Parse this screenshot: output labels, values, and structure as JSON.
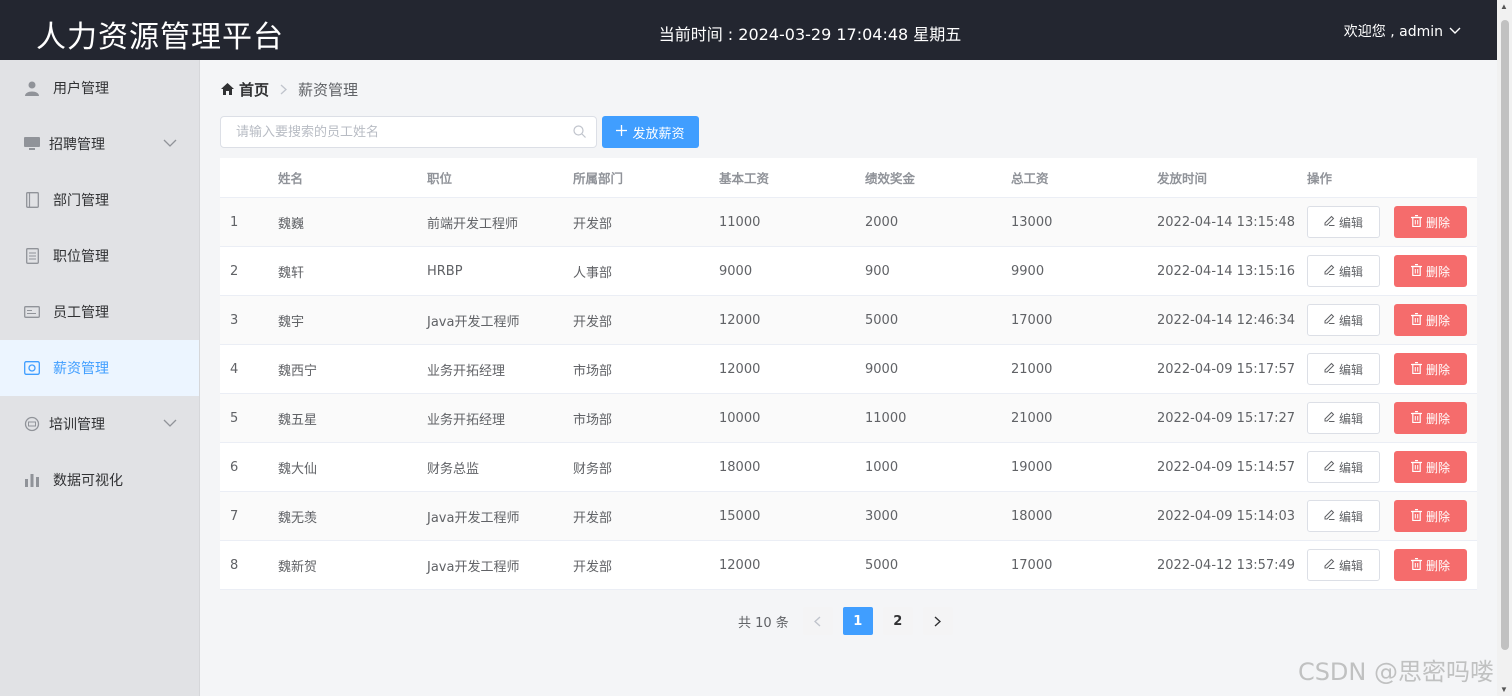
{
  "header": {
    "title": "人力资源管理平台",
    "clock": "当前时间 : 2024-03-29 17:04:48 星期五",
    "user": "欢迎您 , admin"
  },
  "sidebar": {
    "items": [
      {
        "label": "用户管理",
        "icon": "user-icon"
      },
      {
        "label": "招聘管理",
        "icon": "monitor-icon",
        "expandable": true
      },
      {
        "label": "部门管理",
        "icon": "notebook-icon"
      },
      {
        "label": "职位管理",
        "icon": "document-icon"
      },
      {
        "label": "员工管理",
        "icon": "id-card-icon"
      },
      {
        "label": "薪资管理",
        "icon": "money-icon",
        "active": true
      },
      {
        "label": "培训管理",
        "icon": "training-icon",
        "expandable": true
      },
      {
        "label": "数据可视化",
        "icon": "bar-chart-icon"
      }
    ]
  },
  "breadcrumb": {
    "home": "首页",
    "current": "薪资管理"
  },
  "search": {
    "placeholder": "请输入要搜索的员工姓名",
    "value": ""
  },
  "toolbar": {
    "add_label": "发放薪资"
  },
  "table": {
    "headers": [
      "",
      "姓名",
      "职位",
      "所属部门",
      "基本工资",
      "绩效奖金",
      "总工资",
      "发放时间",
      "操作"
    ],
    "rows": [
      [
        "1",
        "魏巍",
        "前端开发工程师",
        "开发部",
        "11000",
        "2000",
        "13000",
        "2022-04-14 13:15:48"
      ],
      [
        "2",
        "魏轩",
        "HRBP",
        "人事部",
        "9000",
        "900",
        "9900",
        "2022-04-14 13:15:16"
      ],
      [
        "3",
        "魏宇",
        "Java开发工程师",
        "开发部",
        "12000",
        "5000",
        "17000",
        "2022-04-14 12:46:34"
      ],
      [
        "4",
        "魏西宁",
        "业务开拓经理",
        "市场部",
        "12000",
        "9000",
        "21000",
        "2022-04-09 15:17:57"
      ],
      [
        "5",
        "魏五星",
        "业务开拓经理",
        "市场部",
        "10000",
        "11000",
        "21000",
        "2022-04-09 15:17:27"
      ],
      [
        "6",
        "魏大仙",
        "财务总监",
        "财务部",
        "18000",
        "1000",
        "19000",
        "2022-04-09 15:14:57"
      ],
      [
        "7",
        "魏无羡",
        "Java开发工程师",
        "开发部",
        "15000",
        "3000",
        "18000",
        "2022-04-09 15:14:03"
      ],
      [
        "8",
        "魏新贺",
        "Java开发工程师",
        "开发部",
        "12000",
        "5000",
        "17000",
        "2022-04-12 13:57:49"
      ]
    ],
    "edit_label": "编辑",
    "delete_label": "删除"
  },
  "pagination": {
    "total": "共 10 条",
    "pages": [
      "1",
      "2"
    ],
    "current": "1"
  },
  "watermark": "CSDN @思密吗喽",
  "colors": {
    "primary": "#409eff",
    "danger": "#f56c6c",
    "header_bg": "#232630",
    "sidebar_bg": "#e1e2e5"
  }
}
